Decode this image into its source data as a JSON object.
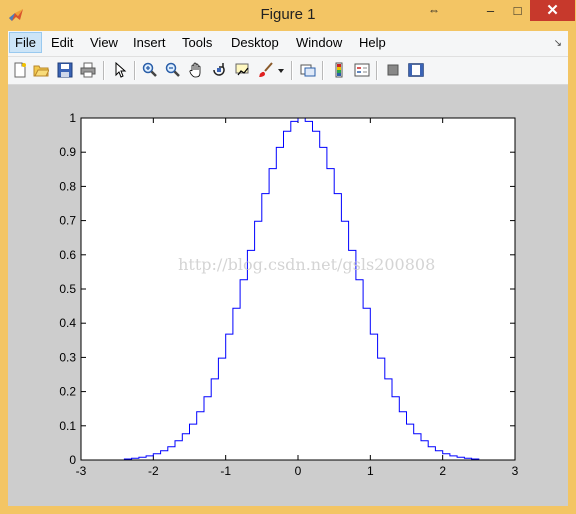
{
  "window": {
    "title": "Figure 1",
    "controls": {
      "restore": "⇔",
      "minimize": "–",
      "maximize": "□",
      "close": "✕"
    }
  },
  "menu": {
    "items": [
      {
        "label": "File",
        "active": true
      },
      {
        "label": "Edit"
      },
      {
        "label": "View"
      },
      {
        "label": "Insert"
      },
      {
        "label": "Tools"
      },
      {
        "label": "Desktop"
      },
      {
        "label": "Window"
      },
      {
        "label": "Help"
      }
    ],
    "dock_arrow": "↘"
  },
  "toolbar": {
    "icons": [
      "new-figure-icon",
      "open-file-icon",
      "save-icon",
      "print-icon",
      "pointer-icon",
      "zoom-in-icon",
      "zoom-out-icon",
      "pan-icon",
      "rotate-3d-icon",
      "data-cursor-icon",
      "brush-icon",
      "brush-dropdown-icon",
      "link-plot-icon",
      "colorbar-icon",
      "legend-icon",
      "hide-plot-tools-icon",
      "show-plot-tools-icon"
    ]
  },
  "watermark": "http://blog.csdn.net/gsls200808",
  "chart_data": {
    "type": "line",
    "style": "stairs",
    "title": "",
    "xlabel": "",
    "ylabel": "",
    "xlim": [
      -3,
      3
    ],
    "ylim": [
      0,
      1
    ],
    "xticks": [
      "-3",
      "-2",
      "-1",
      "0",
      "1",
      "2",
      "3"
    ],
    "yticks": [
      "0",
      "0.1",
      "0.2",
      "0.3",
      "0.4",
      "0.5",
      "0.6",
      "0.7",
      "0.8",
      "0.9",
      "1"
    ],
    "grid": false,
    "series": [
      {
        "color": "#0000ff",
        "bin_width": 0.1,
        "x": [
          -3.0,
          -2.9,
          -2.8,
          -2.7,
          -2.6,
          -2.5,
          -2.4,
          -2.3,
          -2.2,
          -2.1,
          -2.0,
          -1.9,
          -1.8,
          -1.7,
          -1.6,
          -1.5,
          -1.4,
          -1.3,
          -1.2,
          -1.1,
          -1.0,
          -0.9,
          -0.8,
          -0.7,
          -0.6,
          -0.5,
          -0.4,
          -0.3,
          -0.2,
          -0.1,
          0.0,
          0.1,
          0.2,
          0.3,
          0.4,
          0.5,
          0.6,
          0.7,
          0.8,
          0.9,
          1.0,
          1.1,
          1.2,
          1.3,
          1.4,
          1.5,
          1.6,
          1.7,
          1.8,
          1.9,
          2.0,
          2.1,
          2.2,
          2.3,
          2.4,
          2.5,
          2.6,
          2.7,
          2.8,
          2.9
        ],
        "y": [
          0.0,
          0.0,
          0.0,
          0.0,
          0.0,
          0.0,
          0.003,
          0.005,
          0.008,
          0.012,
          0.018,
          0.027,
          0.039,
          0.056,
          0.077,
          0.105,
          0.141,
          0.185,
          0.237,
          0.298,
          0.368,
          0.444,
          0.527,
          0.613,
          0.698,
          0.779,
          0.852,
          0.914,
          0.961,
          0.99,
          1.0,
          0.99,
          0.961,
          0.914,
          0.852,
          0.779,
          0.698,
          0.613,
          0.527,
          0.444,
          0.368,
          0.298,
          0.237,
          0.185,
          0.141,
          0.105,
          0.077,
          0.056,
          0.039,
          0.027,
          0.018,
          0.012,
          0.008,
          0.005,
          0.003,
          0.0,
          0.0,
          0.0,
          0.0,
          0.0
        ]
      }
    ]
  }
}
